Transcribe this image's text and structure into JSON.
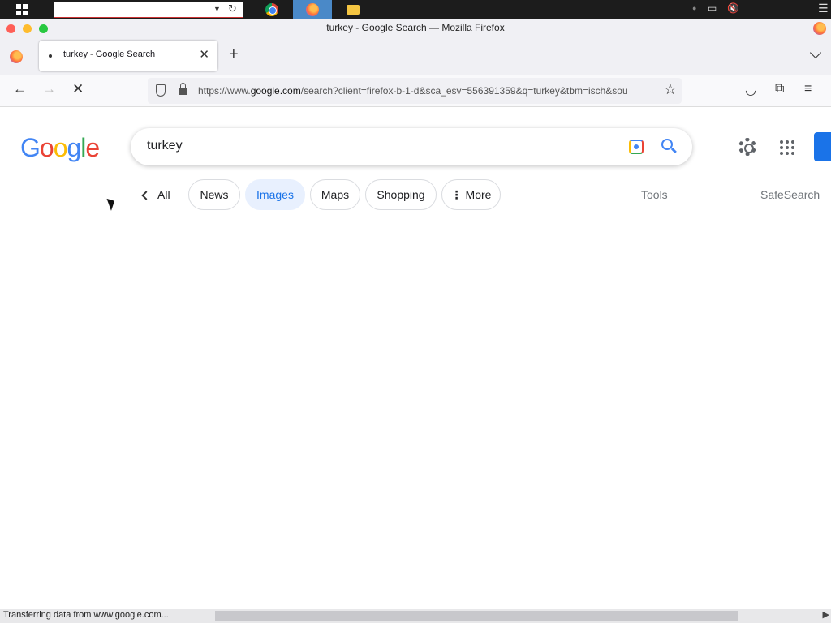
{
  "window": {
    "title": "turkey - Google Search — Mozilla Firefox"
  },
  "taskbar": {
    "search_value": "",
    "apps": [
      "chrome",
      "firefox",
      "file-explorer"
    ],
    "active_app": "firefox"
  },
  "tabs": [
    {
      "label": "turkey - Google Search",
      "active": true
    }
  ],
  "urlbar": {
    "prefix": "https://www.",
    "domain": "google.com",
    "rest": "/search?client=firefox-b-1-d&sca_esv=556391359&q=turkey&tbm=isch&sou"
  },
  "search": {
    "query": "turkey"
  },
  "filters": {
    "all_label": "All",
    "chips": [
      {
        "label": "News",
        "active": false
      },
      {
        "label": "Images",
        "active": true
      },
      {
        "label": "Maps",
        "active": false
      },
      {
        "label": "Shopping",
        "active": false
      },
      {
        "label": "More",
        "active": false
      }
    ],
    "tools_label": "Tools",
    "safesearch_label": "SafeSearch"
  },
  "status": {
    "text": "Transferring data from www.google.com..."
  },
  "colors": {
    "google_blue": "#4285f4",
    "google_red": "#ea4335",
    "google_yellow": "#fbbc05",
    "google_green": "#34a853",
    "active_chip_bg": "#e8f0fe",
    "active_chip_text": "#1a73e8"
  }
}
